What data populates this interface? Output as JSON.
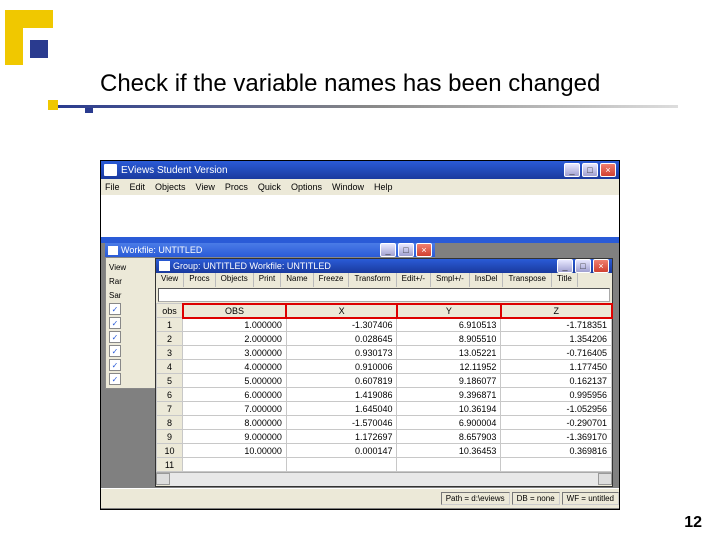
{
  "slide": {
    "title": "Check if the variable names has been changed",
    "page_number": "12"
  },
  "outer_window": {
    "title": "EViews Student Version",
    "menu": [
      "File",
      "Edit",
      "Objects",
      "View",
      "Procs",
      "Quick",
      "Options",
      "Window",
      "Help"
    ]
  },
  "workfile_window": {
    "title": "Workfile: UNTITLED",
    "toolbar_first": "View",
    "left_labels": [
      "Rar",
      "Sar"
    ]
  },
  "group_window": {
    "title": "Group: UNTITLED   Workfile: UNTITLED",
    "toolbar": [
      "View",
      "Procs",
      "Objects",
      "Print",
      "Name",
      "Freeze",
      "Transform",
      "Edit+/-",
      "Smpl+/-",
      "InsDel",
      "Transpose",
      "Title"
    ],
    "obs_label": "obs",
    "headers": [
      "OBS",
      "X",
      "Y",
      "Z"
    ],
    "rows": [
      {
        "i": "1",
        "obs": "1.000000",
        "x": "-1.307406",
        "y": "6.910513",
        "z": "-1.718351"
      },
      {
        "i": "2",
        "obs": "2.000000",
        "x": "0.028645",
        "y": "8.905510",
        "z": "1.354206"
      },
      {
        "i": "3",
        "obs": "3.000000",
        "x": "0.930173",
        "y": "13.05221",
        "z": "-0.716405"
      },
      {
        "i": "4",
        "obs": "4.000000",
        "x": "0.910006",
        "y": "12.11952",
        "z": "1.177450"
      },
      {
        "i": "5",
        "obs": "5.000000",
        "x": "0.607819",
        "y": "9.186077",
        "z": "0.162137"
      },
      {
        "i": "6",
        "obs": "6.000000",
        "x": "1.419086",
        "y": "9.396871",
        "z": "0.995956"
      },
      {
        "i": "7",
        "obs": "7.000000",
        "x": "1.645040",
        "y": "10.36194",
        "z": "-1.052956"
      },
      {
        "i": "8",
        "obs": "8.000000",
        "x": "-1.570046",
        "y": "6.900004",
        "z": "-0.290701"
      },
      {
        "i": "9",
        "obs": "9.000000",
        "x": "1.172697",
        "y": "8.657903",
        "z": "-1.369170"
      },
      {
        "i": "10",
        "obs": "10.00000",
        "x": "0.000147",
        "y": "10.36453",
        "z": "0.369816"
      },
      {
        "i": "11",
        "obs": "",
        "x": "",
        "y": "",
        "z": ""
      }
    ]
  },
  "status_bar": {
    "path": "Path = d:\\eviews",
    "db": "DB = none",
    "wf": "WF = untitled"
  }
}
